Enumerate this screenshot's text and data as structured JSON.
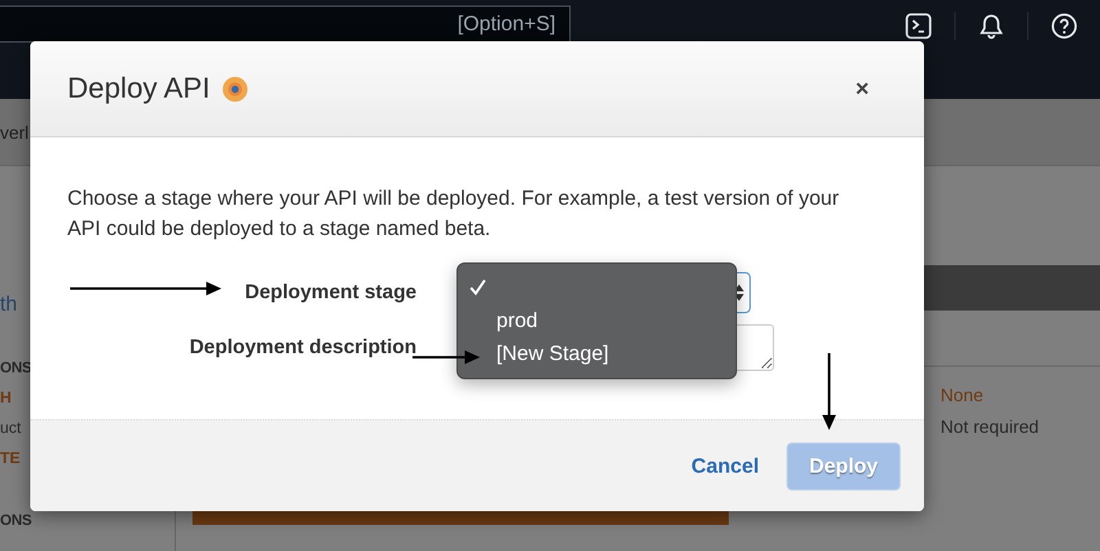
{
  "top_bar": {
    "search": {
      "shortcut": "[Option+S]"
    }
  },
  "background": {
    "header_fragment": "verl",
    "sidebar": [
      {
        "text": "th",
        "kind": "link"
      },
      {
        "text": "ONS",
        "kind": "heading"
      },
      {
        "text": "H",
        "kind": "accent"
      },
      {
        "text": "uct",
        "kind": "text"
      },
      {
        "text": "TE",
        "kind": "accent"
      },
      {
        "text": "ONS",
        "kind": "heading"
      }
    ],
    "details": [
      {
        "text": "None",
        "kind": "accent"
      },
      {
        "text": "Not required",
        "kind": "text"
      }
    ]
  },
  "modal": {
    "title": "Deploy API",
    "close": "×",
    "description": "Choose a stage where your API will be deployed. For example, a test version of your API could be deployed to a stage named beta.",
    "fields": [
      {
        "label": "Deployment stage",
        "kind": "select"
      },
      {
        "label": "Deployment description",
        "kind": "textarea"
      }
    ],
    "dropdown": [
      {
        "selected": true
      },
      {
        "label": "prod",
        "selected": false
      },
      {
        "label": "[New Stage]",
        "selected": false
      }
    ],
    "cancel": "Cancel",
    "deploy": {
      "label": "Deploy",
      "disabled": true
    }
  }
}
